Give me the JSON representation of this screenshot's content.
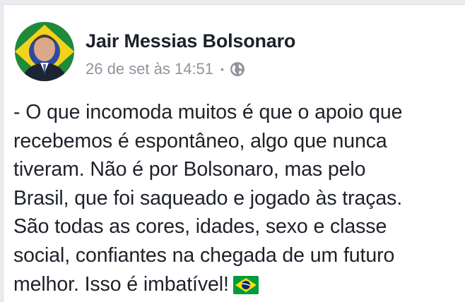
{
  "post": {
    "author": "Jair Messias Bolsonaro",
    "timestamp": "26 de set às 14:51",
    "separator": "•",
    "audience_icon": "globe-icon",
    "text_lines": [
      "- O que incomoda muitos é que o apoio que",
      "recebemos é espontâneo, algo que nunca",
      "tiveram. Não é por Bolsonaro, mas pelo",
      "Brasil, que foi saqueado e jogado às traças.",
      "São todas as cores, idades, sexo e classe",
      "social, confiantes na chegada de um futuro",
      "melhor. Isso é imbatível!"
    ],
    "emoji": "brazil-flag-icon"
  },
  "colors": {
    "author": "#1d2129",
    "meta": "#90949c",
    "text": "#1d2129",
    "flag_green": "#009c3b",
    "flag_yellow": "#ffdf00",
    "flag_blue": "#002776"
  }
}
